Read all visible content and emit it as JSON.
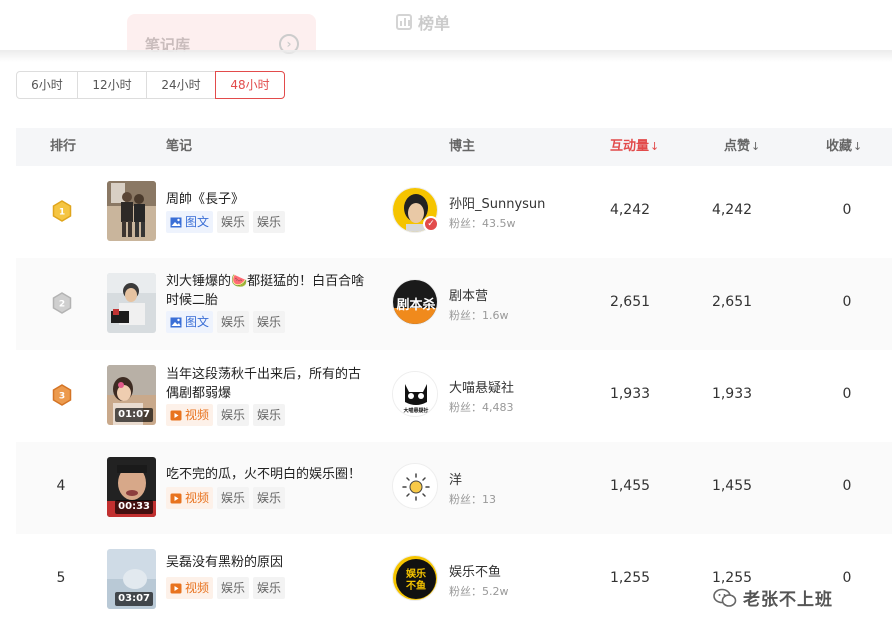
{
  "header": {
    "notes_tab_label": "笔记库",
    "rank_tab_label": "榜单"
  },
  "time_filter": {
    "options": [
      "6小时",
      "12小时",
      "24小时",
      "48小时"
    ],
    "selected": "48小时"
  },
  "table": {
    "columns": {
      "rank": "排行",
      "note": "笔记",
      "blogger": "博主",
      "interactions": "互动量",
      "likes": "点赞",
      "favorites": "收藏"
    },
    "sort_marker": "↓",
    "fans_prefix": "粉丝：",
    "rows": [
      {
        "rank": "1",
        "medal": "gold",
        "title": "周帥《長子》",
        "type": "图文",
        "type_icon": "image-icon",
        "tags": [
          "娱乐",
          "娱乐"
        ],
        "duration": "",
        "blogger": "孙阳_Sunnysun",
        "fans": "43.5w",
        "verified": true,
        "interactions": "4,242",
        "likes": "4,242",
        "favorites": "0"
      },
      {
        "rank": "2",
        "medal": "silver",
        "title": "刘大锤爆的🍉都挺猛的！白百合啥时候二胎",
        "type": "图文",
        "type_icon": "image-icon",
        "tags": [
          "娱乐",
          "娱乐"
        ],
        "duration": "",
        "blogger": "剧本营",
        "fans": "1.6w",
        "verified": false,
        "interactions": "2,651",
        "likes": "2,651",
        "favorites": "0"
      },
      {
        "rank": "3",
        "medal": "bronze",
        "title": "当年这段荡秋千出来后，所有的古偶剧都弱爆",
        "type": "视频",
        "type_icon": "video-icon",
        "tags": [
          "娱乐",
          "娱乐"
        ],
        "duration": "01:07",
        "blogger": "大喵悬疑社",
        "fans": "4,483",
        "verified": false,
        "interactions": "1,933",
        "likes": "1,933",
        "favorites": "0"
      },
      {
        "rank": "4",
        "medal": "",
        "title": "吃不完的瓜，火不明白的娱乐圈！",
        "type": "视频",
        "type_icon": "video-icon",
        "tags": [
          "娱乐",
          "娱乐"
        ],
        "duration": "00:33",
        "blogger": "洋",
        "fans": "13",
        "verified": false,
        "interactions": "1,455",
        "likes": "1,455",
        "favorites": "0"
      },
      {
        "rank": "5",
        "medal": "",
        "title": "吴磊没有黑粉的原因",
        "type": "视频",
        "type_icon": "video-icon",
        "tags": [
          "娱乐",
          "娱乐"
        ],
        "duration": "03:07",
        "blogger": "娱乐不鱼",
        "fans": "5.2w",
        "verified": false,
        "interactions": "1,255",
        "likes": "1,255",
        "favorites": "0"
      }
    ]
  },
  "avatars": {
    "row2_text": "剧本杀",
    "row3_text": "大喵悬疑社",
    "row5_text": "娱乐不鱼"
  },
  "watermark": {
    "text": "老张不上班"
  },
  "colors": {
    "accent": "#e24b4b",
    "gold": "#f2b01e",
    "silver": "#b9b9b9",
    "bronze": "#e07b2e",
    "pic_tag": "#3b6fd6",
    "video_tag": "#e8731f"
  }
}
